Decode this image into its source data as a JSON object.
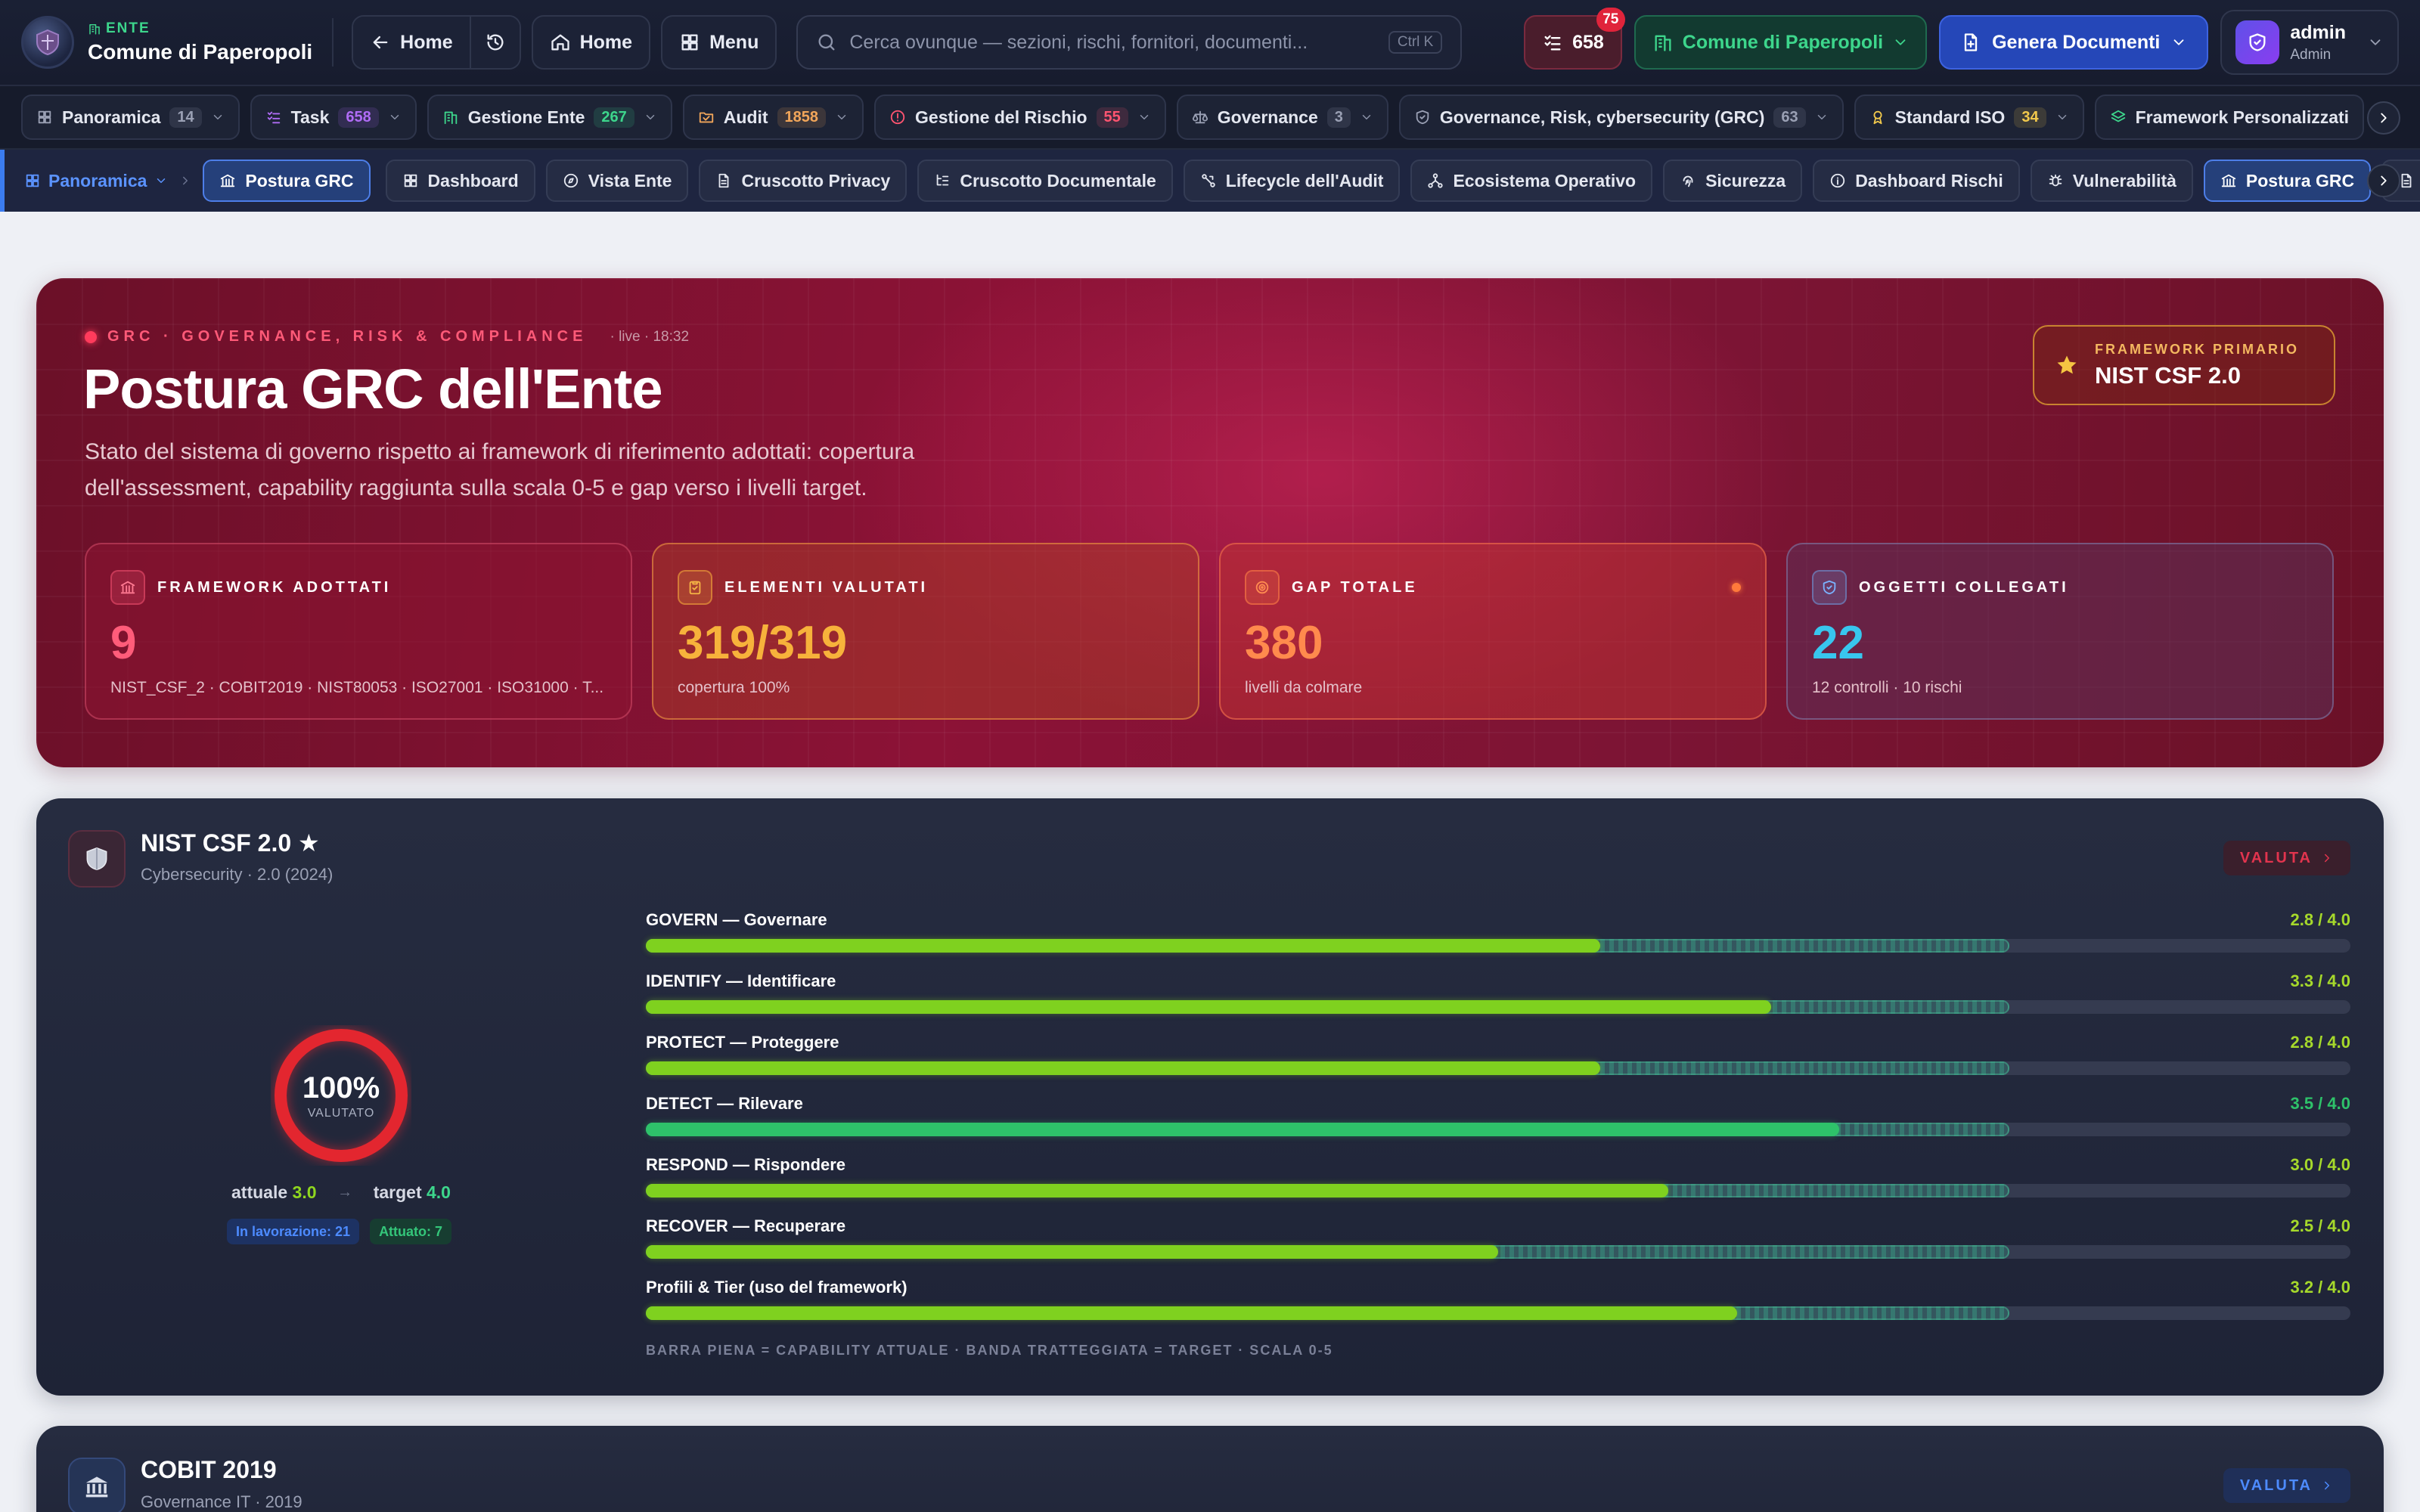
{
  "topbar": {
    "ente_tag": "ENTE",
    "ente_name": "Comune di Paperopoli",
    "home_back_label": "Home",
    "home_label": "Home",
    "menu_label": "Menu",
    "search_placeholder": "Cerca ovunque — sezioni, rischi, fornitori, documenti...",
    "search_shortcut": "Ctrl K",
    "tasks_count": "658",
    "notifications": "75",
    "ente_selector": "Comune di Paperopoli",
    "generate_label": "Genera Documenti",
    "user_name": "admin",
    "user_role": "Admin"
  },
  "modules": [
    {
      "label": "Panoramica",
      "count": "14",
      "color": "#9aa0b4",
      "icon": "grid-icon"
    },
    {
      "label": "Task",
      "count": "658",
      "color": "#b06cf5",
      "icon": "tasks-icon"
    },
    {
      "label": "Gestione Ente",
      "count": "267",
      "color": "#3dd68c",
      "icon": "building-icon"
    },
    {
      "label": "Audit",
      "count": "1858",
      "color": "#f2a65a",
      "icon": "folder-icon"
    },
    {
      "label": "Gestione del Rischio",
      "count": "55",
      "color": "#ff5470",
      "icon": "alert-icon"
    },
    {
      "label": "Governance",
      "count": "3",
      "color": "#9aa0b4",
      "icon": "scale-icon"
    },
    {
      "label": "Governance, Risk, cybersecurity (GRC)",
      "count": "63",
      "color": "#9aa0b4",
      "icon": "shield-icon"
    },
    {
      "label": "Standard ISO",
      "count": "34",
      "color": "#f2c94c",
      "icon": "award-icon"
    },
    {
      "label": "Framework Personalizzati",
      "count": "",
      "color": "#3dd68c",
      "icon": "layers-icon"
    }
  ],
  "breadcrumb": {
    "label": "Panoramica",
    "current": "Postura GRC"
  },
  "subtabs": [
    "Dashboard",
    "Vista Ente",
    "Cruscotto Privacy",
    "Cruscotto Documentale",
    "Lifecycle dell'Audit",
    "Ecosistema Operativo",
    "Sicurezza",
    "Dashboard Rischi",
    "Vulnerabilità",
    "Postura GRC"
  ],
  "hero": {
    "eyebrow": "GRC · GOVERNANCE, RISK & COMPLIANCE",
    "live": "· live · 18:32",
    "title": "Postura GRC dell'Ente",
    "description": "Stato del sistema di governo rispetto ai framework di riferimento adottati: copertura dell'assessment, capability raggiunta sulla scala 0-5 e gap verso i livelli target.",
    "primary_label": "FRAMEWORK PRIMARIO",
    "primary_value": "NIST CSF 2.0",
    "kpis": [
      {
        "label": "FRAMEWORK ADOTTATI",
        "value": "9",
        "sub": "NIST_CSF_2 · COBIT2019 · NIST80053 · ISO27001 · ISO31000 · T..."
      },
      {
        "label": "ELEMENTI VALUTATI",
        "value": "319/319",
        "sub": "copertura 100%"
      },
      {
        "label": "GAP TOTALE",
        "value": "380",
        "sub": "livelli da colmare"
      },
      {
        "label": "OGGETTI COLLEGATI",
        "value": "22",
        "sub": "12 controlli · 10 rischi"
      }
    ]
  },
  "nist": {
    "title": "NIST CSF 2.0 ★",
    "subtitle": "Cybersecurity · 2.0 (2024)",
    "action": "VALUTA",
    "coverage_pct": "100%",
    "coverage_label": "VALUTATO",
    "coverage_value": 1.0,
    "attuale_label": "attuale",
    "attuale_value": "3.0",
    "target_label": "target",
    "target_value": "4.0",
    "badge_progress": "In lavorazione: 21",
    "badge_done": "Attuato: 7",
    "scale_max": 5,
    "functions": [
      {
        "label": "GOVERN — Governare",
        "current": 2.8,
        "target": 4.0,
        "text": "2.8 / 4.0"
      },
      {
        "label": "IDENTIFY — Identificare",
        "current": 3.3,
        "target": 4.0,
        "text": "3.3 / 4.0"
      },
      {
        "label": "PROTECT — Proteggere",
        "current": 2.8,
        "target": 4.0,
        "text": "2.8 / 4.0"
      },
      {
        "label": "DETECT — Rilevare",
        "current": 3.5,
        "target": 4.0,
        "text": "3.5 / 4.0"
      },
      {
        "label": "RESPOND — Rispondere",
        "current": 3.0,
        "target": 4.0,
        "text": "3.0 / 4.0"
      },
      {
        "label": "RECOVER — Recuperare",
        "current": 2.5,
        "target": 4.0,
        "text": "2.5 / 4.0"
      },
      {
        "label": "Profili & Tier (uso del framework)",
        "current": 3.2,
        "target": 4.0,
        "text": "3.2 / 4.0"
      }
    ],
    "legend": "BARRA PIENA = CAPABILITY ATTUALE · BANDA TRATTEGGIATA = TARGET · SCALA 0-5"
  },
  "cobit": {
    "title": "COBIT 2019",
    "subtitle": "Governance IT · 2019",
    "action": "VALUTA"
  }
}
